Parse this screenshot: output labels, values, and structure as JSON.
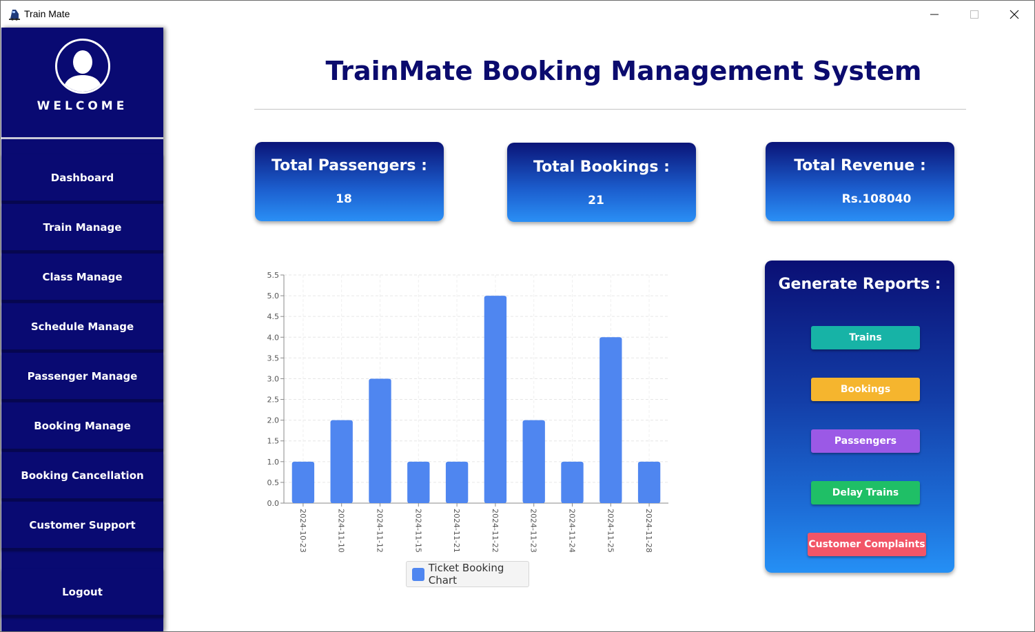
{
  "window": {
    "title": "Train Mate",
    "icon": "train-icon"
  },
  "sidebar": {
    "welcome": "WELCOME",
    "avatar_icon": "user-avatar-icon",
    "items": [
      {
        "label": "Dashboard"
      },
      {
        "label": "Train Manage"
      },
      {
        "label": "Class Manage"
      },
      {
        "label": "Schedule Manage"
      },
      {
        "label": "Passenger Manage"
      },
      {
        "label": "Booking Manage"
      },
      {
        "label": "Booking Cancellation"
      },
      {
        "label": "Customer Support"
      }
    ],
    "logout": "Logout"
  },
  "header": {
    "title": "TrainMate Booking Management System"
  },
  "stats": [
    {
      "label": "Total Passengers :",
      "value": "18"
    },
    {
      "label": "Total Bookings :",
      "value": "21"
    },
    {
      "label": "Total Revenue :",
      "value": "Rs.108040"
    }
  ],
  "chart_data": {
    "type": "bar",
    "categories": [
      "2024-10-23",
      "2024-11-10",
      "2024-11-12",
      "2024-11-15",
      "2024-11-21",
      "2024-11-22",
      "2024-11-23",
      "2024-11-24",
      "2024-11-25",
      "2024-11-28"
    ],
    "series": [
      {
        "name": "Ticket Booking Chart",
        "values": [
          1,
          2,
          3,
          1,
          1,
          5,
          2,
          1,
          4,
          1
        ]
      }
    ],
    "ylim": [
      0,
      5.5
    ],
    "yticks": [
      "0.0",
      "0.5",
      "1.0",
      "1.5",
      "2.0",
      "2.5",
      "3.0",
      "3.5",
      "4.0",
      "4.5",
      "5.0",
      "5.5"
    ],
    "grid": true,
    "legend": "bottom",
    "bar_color": "#4f86f0"
  },
  "reports": {
    "title": "Generate Reports :",
    "buttons": [
      {
        "label": "Trains",
        "color": "#17b3a6"
      },
      {
        "label": "Bookings",
        "color": "#f5b52e"
      },
      {
        "label": "Passengers",
        "color": "#9b59e6"
      },
      {
        "label": "Delay Trains",
        "color": "#1fbf66"
      },
      {
        "label": "Customer Complaints",
        "color": "#f25567"
      }
    ]
  }
}
